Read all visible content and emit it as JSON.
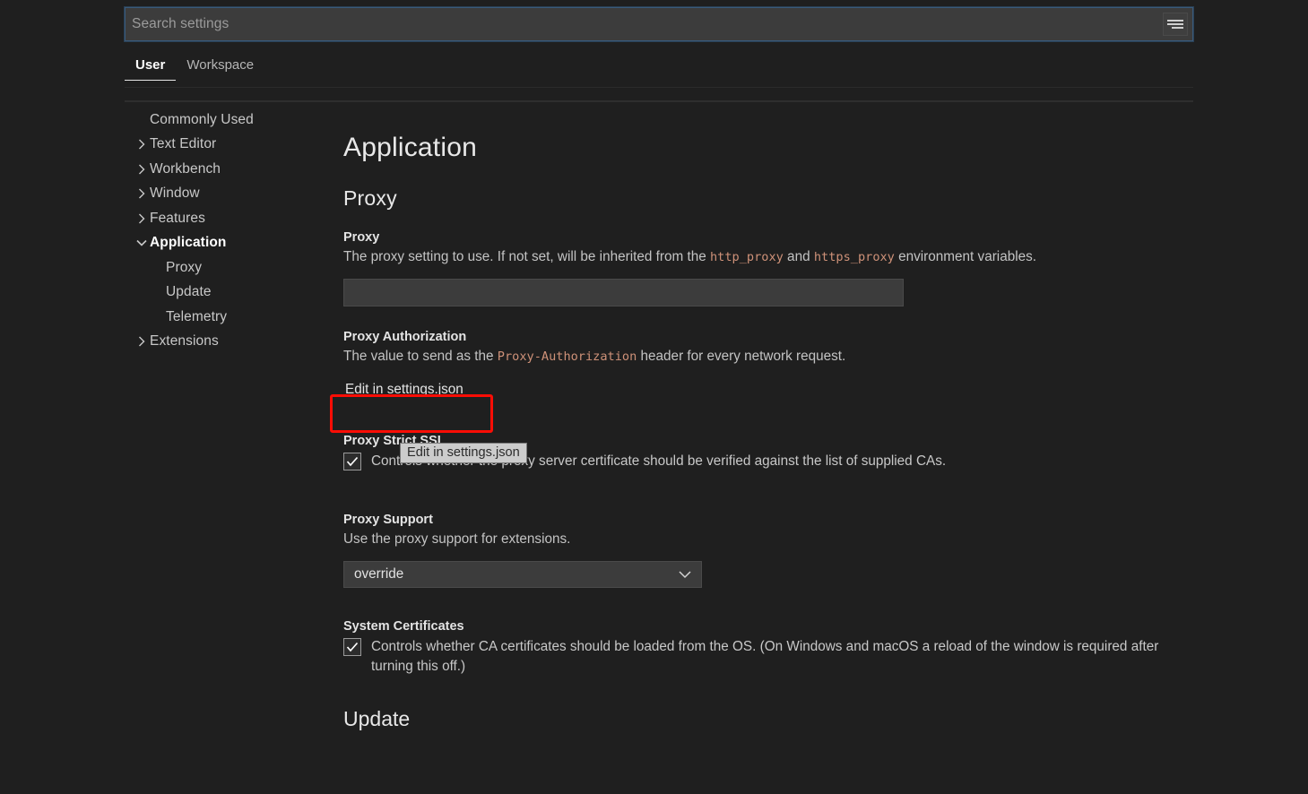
{
  "search": {
    "placeholder": "Search settings",
    "value": "",
    "filter_icon": "filter-icon"
  },
  "tabs": [
    {
      "label": "User",
      "active": true
    },
    {
      "label": "Workspace",
      "active": false
    }
  ],
  "sidebar": {
    "items": [
      {
        "label": "Commonly Used",
        "twisty": "none",
        "level": 0
      },
      {
        "label": "Text Editor",
        "twisty": "collapsed",
        "level": 0
      },
      {
        "label": "Workbench",
        "twisty": "collapsed",
        "level": 0
      },
      {
        "label": "Window",
        "twisty": "collapsed",
        "level": 0
      },
      {
        "label": "Features",
        "twisty": "collapsed",
        "level": 0
      },
      {
        "label": "Application",
        "twisty": "expanded",
        "level": 0
      },
      {
        "label": "Proxy",
        "twisty": "none",
        "level": 1
      },
      {
        "label": "Update",
        "twisty": "none",
        "level": 1
      },
      {
        "label": "Telemetry",
        "twisty": "none",
        "level": 1
      },
      {
        "label": "Extensions",
        "twisty": "collapsed",
        "level": 0
      }
    ]
  },
  "main": {
    "app_title": "Application",
    "group_title": "Proxy",
    "bottom_title": "Update",
    "proxy": {
      "label": "Proxy",
      "desc_pre": "The proxy setting to use. If not set, will be inherited from the ",
      "code1": "http_proxy",
      "desc_mid": " and ",
      "code2": "https_proxy",
      "desc_post": " environment variables.",
      "input_value": "",
      "input_placeholder": ""
    },
    "proxy_authorization": {
      "label": "Proxy Authorization",
      "desc_pre": "The value to send as the ",
      "code1": "Proxy-Authorization",
      "desc_post": " header for every network request.",
      "link_label": "Edit in settings.json",
      "tooltip": "Edit in settings.json"
    },
    "proxy_strict_ssl": {
      "label": "Proxy Strict SSL",
      "desc": "Controls whether the proxy server certificate should be verified against the list of supplied CAs.",
      "checked": true
    },
    "proxy_support": {
      "label": "Proxy Support",
      "desc": "Use the proxy support for extensions.",
      "value": "override"
    },
    "system_certificates": {
      "label": "System Certificates",
      "desc": "Controls whether CA certificates should be loaded from the OS. (On Windows and macOS a reload of the window is required after turning this off.)",
      "checked": true
    }
  },
  "colors": {
    "background": "#1f1f1f",
    "input_background": "#3c3c3c",
    "code_text": "#ce9178",
    "highlight_border": "#fb0d05",
    "focus_border": "#3a5a7a",
    "tooltip_background": "#cccccc"
  }
}
